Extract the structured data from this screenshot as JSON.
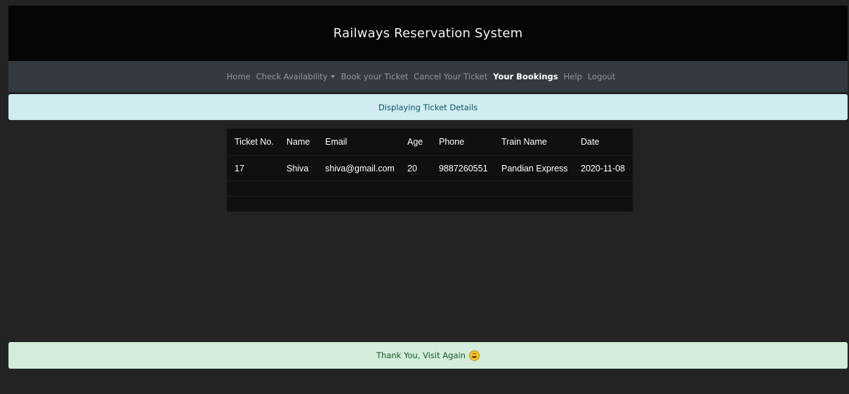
{
  "header": {
    "title": "Railways Reservation System"
  },
  "nav": {
    "items": [
      {
        "label": "Home"
      },
      {
        "label": "Check Availability"
      },
      {
        "label": "Book your Ticket"
      },
      {
        "label": "Cancel Your Ticket"
      },
      {
        "label": "Your Bookings"
      },
      {
        "label": "Help"
      },
      {
        "label": "Logout"
      }
    ],
    "active": "Your Bookings"
  },
  "info_alert": {
    "text": "Displaying Ticket Details"
  },
  "table": {
    "columns": [
      "Ticket No.",
      "Name",
      "Email",
      "Age",
      "Phone",
      "Train Name",
      "Date"
    ],
    "rows": [
      [
        "17",
        "Shiva",
        "shiva@gmail.com",
        "20",
        "9887260551",
        "Pandian Express",
        "2020-11-08"
      ]
    ]
  },
  "footer_alert": {
    "text": "Thank You, Visit Again",
    "icon": "grinning-face-icon"
  },
  "colors": {
    "page_bg": "#232323",
    "header_bg": "#050505",
    "nav_bg": "#343a40",
    "info_alert_bg": "#d1ecf1",
    "info_alert_text": "#0c5460",
    "success_alert_bg": "#d4edda",
    "success_alert_text": "#155724",
    "table_bg": "#101010"
  }
}
